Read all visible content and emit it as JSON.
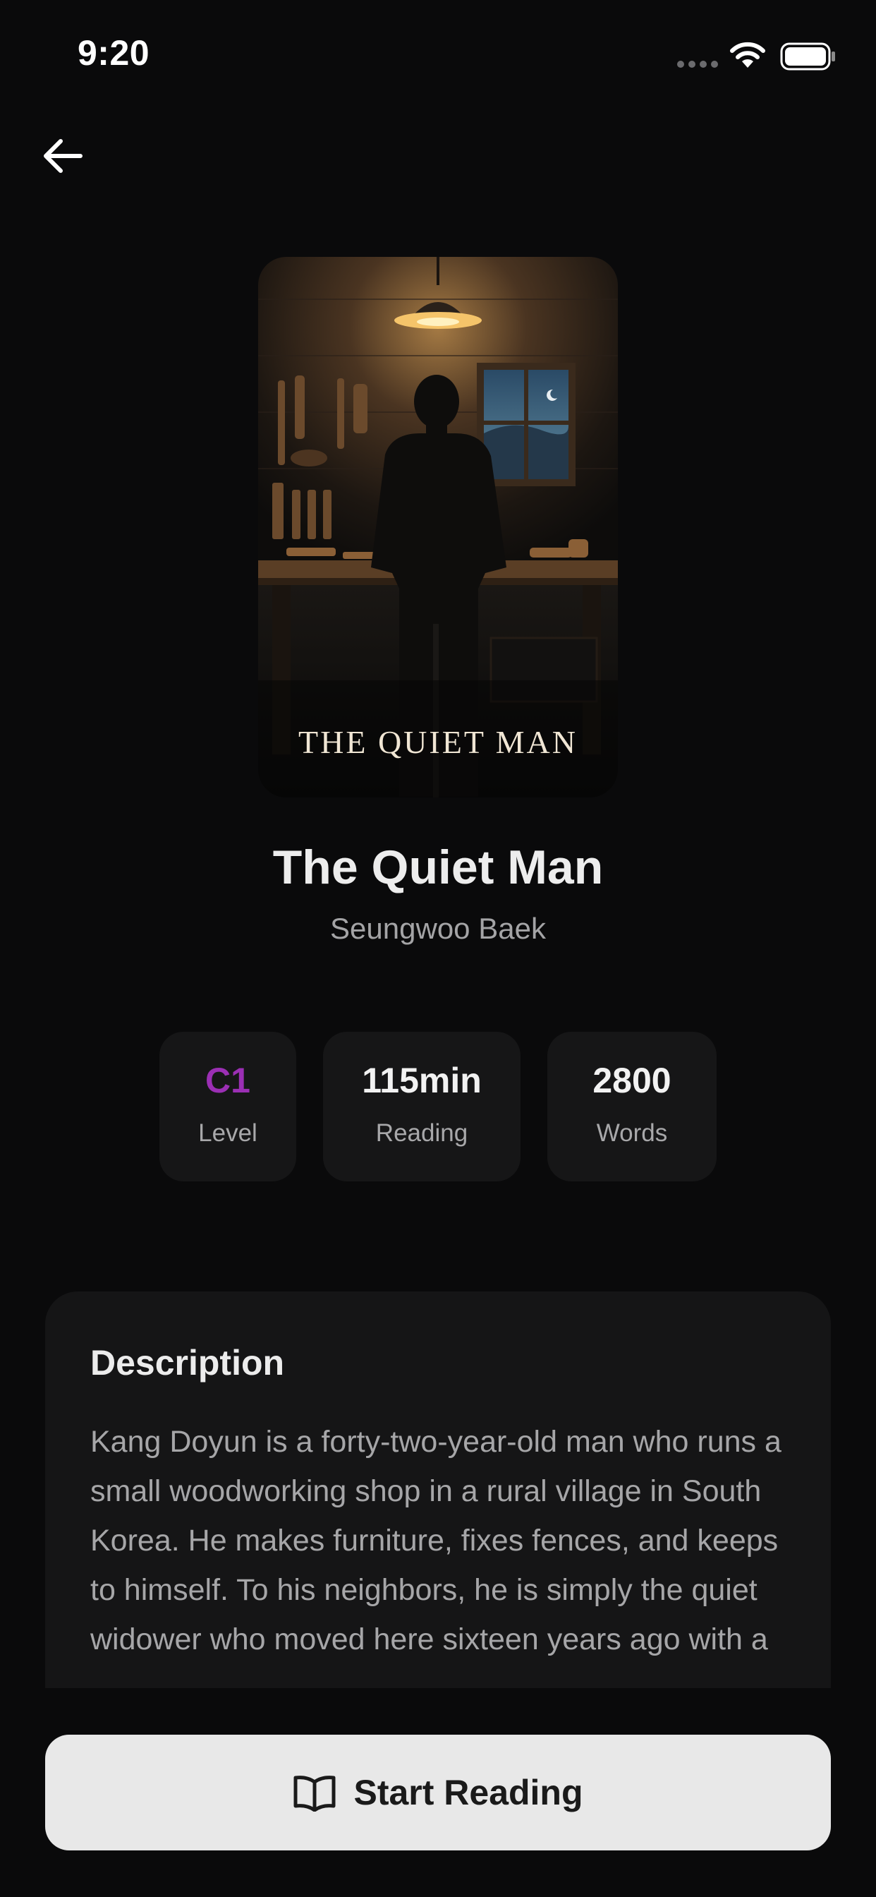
{
  "status_bar": {
    "time": "9:20"
  },
  "navigation": {
    "back_icon": "arrow-left-icon"
  },
  "book": {
    "cover_title": "THE QUIET MAN",
    "title": "The Quiet Man",
    "author": "Seungwoo Baek"
  },
  "stats": [
    {
      "value": "C1",
      "label": "Level"
    },
    {
      "value": "115min",
      "label": "Reading"
    },
    {
      "value": "2800",
      "label": "Words"
    }
  ],
  "description": {
    "heading": "Description",
    "text": "Kang Doyun is a forty-two-year-old man who runs a small woodworking shop in a rural village in South Korea. He makes furniture, fixes fences, and keeps to himself. To his neighbors, he is simply the quiet widower who moved here sixteen years ago with a"
  },
  "action": {
    "label": "Start Reading",
    "icon": "open-book-icon"
  },
  "colors": {
    "background": "#0a0a0b",
    "card": "#161617",
    "level_accent": "#9b2fb4",
    "button_bg": "#e8e8e8"
  }
}
